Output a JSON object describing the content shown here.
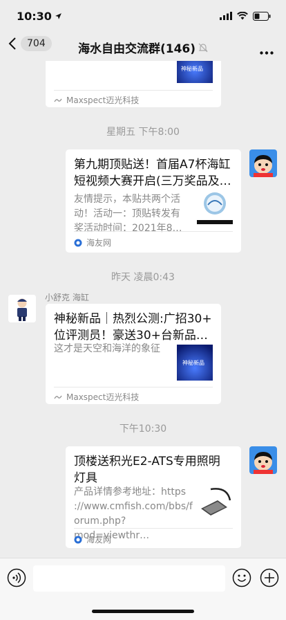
{
  "status_bar": {
    "time": "10:30",
    "location_icon": "location-arrow-icon"
  },
  "nav": {
    "unread_count": "704",
    "title": "海水自由交流群(146)",
    "mute_icon": "bell-muted-icon",
    "more_icon": "more-dots-icon"
  },
  "messages": {
    "card1": {
      "thumb_text": "神秘新品",
      "source": "Maxspect迈光科技"
    },
    "time1": "星期五 下午8:00",
    "card2": {
      "title_line1": "第九期顶贴送！首届A7杯海缸",
      "title_line2": "短视频大赛开启(三万奖品及…",
      "desc_line1": "友情提示，本贴共两个活",
      "desc_line2": "动！活动一：顶贴转发有",
      "desc_line3": "奖活动时间：2021年8…",
      "source": "海友网"
    },
    "time2": "昨天 凌晨0:43",
    "sender_name": "小舒克 海缸",
    "card3": {
      "title_line1": "神秘新品｜热烈公测:广招30+",
      "title_line2": "位评测员！豪送30+台新品…",
      "desc": "这才是天空和海洋的象征",
      "thumb_text": "神秘新品",
      "source": "Maxspect迈光科技"
    },
    "time3": "下午10:30",
    "card4": {
      "title_line1": "顶楼送积光E2-ATS专用照明",
      "title_line2": "灯具",
      "desc_line1": "产品详情参考地址：https",
      "desc_line2": "://www.cmfish.com/bbs/f",
      "desc_line3": "orum.php?mod=viewthr…",
      "source": "海友网"
    }
  },
  "colors": {
    "chat_bg": "#ededed",
    "card_bg": "#ffffff",
    "meta_text": "#888888"
  }
}
